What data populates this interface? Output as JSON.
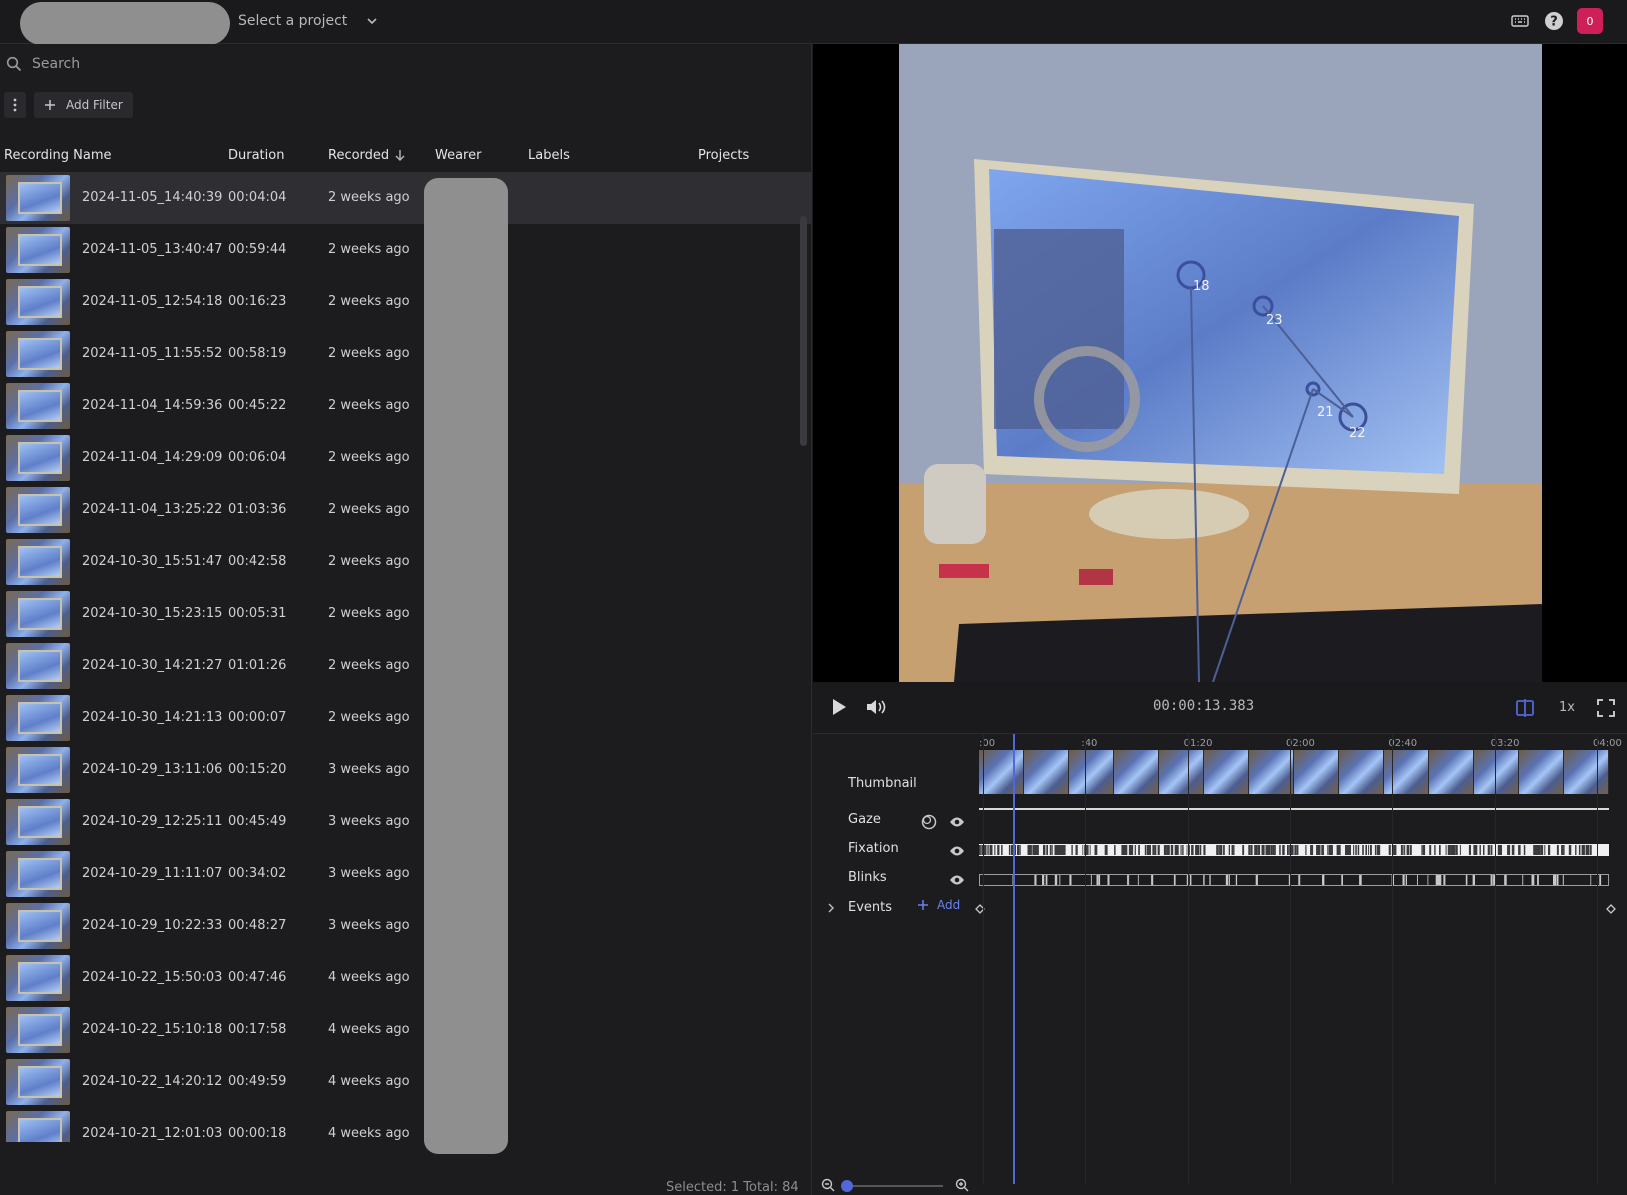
{
  "topbar": {
    "project_placeholder": "Select a project",
    "notification_count": "0",
    "icons": [
      "keyboard-icon",
      "help-icon"
    ]
  },
  "list": {
    "search_placeholder": "Search",
    "add_filter_label": "Add Filter",
    "columns": {
      "name": "Recording Name",
      "duration": "Duration",
      "recorded": "Recorded",
      "wearer": "Wearer",
      "labels": "Labels",
      "projects": "Projects"
    },
    "rows": [
      {
        "name": "2024-11-05_14:40:39",
        "duration": "00:04:04",
        "recorded": "2 weeks ago"
      },
      {
        "name": "2024-11-05_13:40:47",
        "duration": "00:59:44",
        "recorded": "2 weeks ago"
      },
      {
        "name": "2024-11-05_12:54:18",
        "duration": "00:16:23",
        "recorded": "2 weeks ago"
      },
      {
        "name": "2024-11-05_11:55:52",
        "duration": "00:58:19",
        "recorded": "2 weeks ago"
      },
      {
        "name": "2024-11-04_14:59:36",
        "duration": "00:45:22",
        "recorded": "2 weeks ago"
      },
      {
        "name": "2024-11-04_14:29:09",
        "duration": "00:06:04",
        "recorded": "2 weeks ago"
      },
      {
        "name": "2024-11-04_13:25:22",
        "duration": "01:03:36",
        "recorded": "2 weeks ago"
      },
      {
        "name": "2024-10-30_15:51:47",
        "duration": "00:42:58",
        "recorded": "2 weeks ago"
      },
      {
        "name": "2024-10-30_15:23:15",
        "duration": "00:05:31",
        "recorded": "2 weeks ago"
      },
      {
        "name": "2024-10-30_14:21:27",
        "duration": "01:01:26",
        "recorded": "2 weeks ago"
      },
      {
        "name": "2024-10-30_14:21:13",
        "duration": "00:00:07",
        "recorded": "2 weeks ago"
      },
      {
        "name": "2024-10-29_13:11:06",
        "duration": "00:15:20",
        "recorded": "3 weeks ago"
      },
      {
        "name": "2024-10-29_12:25:11",
        "duration": "00:45:49",
        "recorded": "3 weeks ago"
      },
      {
        "name": "2024-10-29_11:11:07",
        "duration": "00:34:02",
        "recorded": "3 weeks ago"
      },
      {
        "name": "2024-10-29_10:22:33",
        "duration": "00:48:27",
        "recorded": "3 weeks ago"
      },
      {
        "name": "2024-10-22_15:50:03",
        "duration": "00:47:46",
        "recorded": "4 weeks ago"
      },
      {
        "name": "2024-10-22_15:10:18",
        "duration": "00:17:58",
        "recorded": "4 weeks ago"
      },
      {
        "name": "2024-10-22_14:20:12",
        "duration": "00:49:59",
        "recorded": "4 weeks ago"
      },
      {
        "name": "2024-10-21_12:01:03",
        "duration": "00:00:18",
        "recorded": "4 weeks ago"
      }
    ],
    "footer": "Selected: 1  Total: 84"
  },
  "player": {
    "current_time": "00:00:13.383",
    "speed": "1x",
    "fixation_ids": [
      "18",
      "23",
      "21",
      "22"
    ]
  },
  "timeline": {
    "ruler": [
      ":00",
      ":40",
      "01:20",
      "02:00",
      "02:40",
      "03:20",
      "04:00"
    ],
    "tracks": {
      "thumbnail": "Thumbnail",
      "gaze": "Gaze",
      "fixation": "Fixation",
      "blinks": "Blinks",
      "events": "Events"
    },
    "add_event_label": "Add"
  },
  "colors": {
    "accent": "#5068d8",
    "badge": "#cf1f57",
    "panel": "#1c1c1f"
  }
}
